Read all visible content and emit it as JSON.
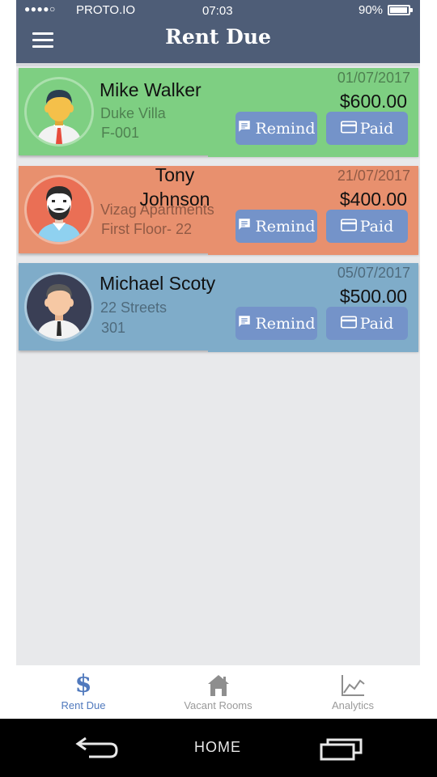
{
  "status_bar": {
    "signal": "●●●●○",
    "carrier": "PROTO.IO",
    "time": "07:03",
    "battery": "90%"
  },
  "header": {
    "title": "Rent Due"
  },
  "tenants": [
    {
      "name": "Mike Walker",
      "property": "Duke Villa",
      "unit": "F-001",
      "due_date": "01/07/2017",
      "amount": "$600.00",
      "card_color": "#7ecf82",
      "avatar_bg": "#7ecf82"
    },
    {
      "name": "Tony Johnson",
      "property": "Vizag Apartments",
      "unit": "First Floor- 22",
      "due_date": "21/07/2017",
      "amount": "$400.00",
      "card_color": "#e8906e",
      "avatar_bg": "#ea6f55"
    },
    {
      "name": "Michael Scoty",
      "property": "22 Streets",
      "unit": "301",
      "due_date": "05/07/2017",
      "amount": "$500.00",
      "card_color": "#7facc9",
      "avatar_bg": "#3a3f55"
    }
  ],
  "actions": {
    "remind_label": "Remind",
    "paid_label": "Paid",
    "button_color": "#7493c9"
  },
  "bottom_nav": [
    {
      "label": "Rent Due",
      "icon": "dollar-icon",
      "active": true
    },
    {
      "label": "Vacant Rooms",
      "icon": "house-icon",
      "active": false
    },
    {
      "label": "Analytics",
      "icon": "chart-icon",
      "active": false
    }
  ],
  "system_nav": {
    "home_label": "HOME"
  },
  "colors": {
    "header_bg": "#4e5d77",
    "accent": "#5079bd"
  }
}
